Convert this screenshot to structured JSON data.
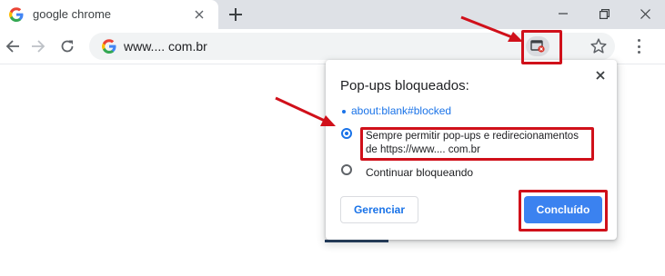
{
  "tab": {
    "title": "google chrome",
    "favicon": "google-g-icon"
  },
  "omnibox": {
    "url": "www.... com.br"
  },
  "popup": {
    "title": "Pop-ups bloqueados:",
    "blocked_items": [
      "about:blank#blocked"
    ],
    "options": {
      "allow_line1": "Sempre permitir pop-ups e redirecionamentos",
      "allow_line2": "de https://www.... com.br",
      "block": "Continuar bloqueando"
    },
    "selected_option": "allow",
    "buttons": {
      "manage": "Gerenciar",
      "done": "Concluído"
    }
  },
  "colors": {
    "accent": "#1a73e8",
    "primary_button": "#3b82f0",
    "annotation_red": "#d0101a",
    "tabstrip": "#dee1e6",
    "omnibox": "#f1f3f4"
  }
}
